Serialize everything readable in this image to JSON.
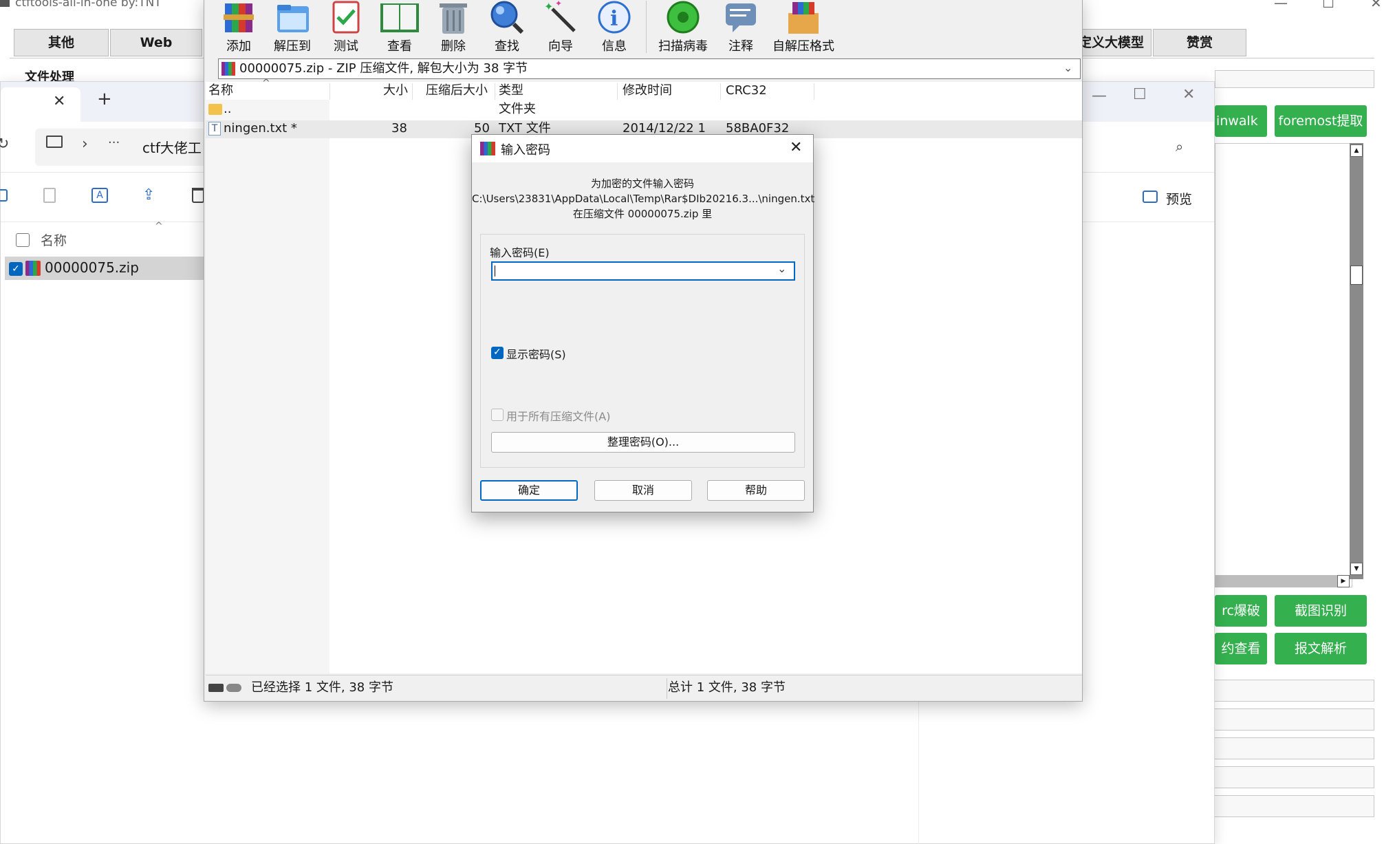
{
  "ctf": {
    "title": "ctftools-all-in-one    by:TNT",
    "tabs": [
      "其他",
      "Web",
      "定义大模型",
      "赞赏"
    ],
    "section": "文件处理",
    "buttons": [
      "inwalk",
      "foremost提取",
      "rc爆破",
      "截图识别",
      "约查看",
      "报文解析"
    ],
    "stray_text": "o。"
  },
  "explorer": {
    "new_tab": "+",
    "breadcrumb_more": "···",
    "breadcrumb_path": "ctf大佬工",
    "preview_label": "预览",
    "col_name": "名称",
    "file_name": "00000075.zip"
  },
  "winrar": {
    "toolbar": [
      "添加",
      "解压到",
      "测试",
      "查看",
      "删除",
      "查找",
      "向导",
      "信息",
      "扫描病毒",
      "注释",
      "自解压格式"
    ],
    "path": "00000075.zip - ZIP 压缩文件, 解包大小为 38 字节",
    "columns": [
      "名称",
      "大小",
      "压缩后大小",
      "类型",
      "修改时间",
      "CRC32"
    ],
    "rows": [
      {
        "name": "..",
        "size": "",
        "packed": "",
        "type": "文件夹",
        "modified": "",
        "crc": ""
      },
      {
        "name": "ningen.txt *",
        "size": "38",
        "packed": "50",
        "type": "TXT 文件",
        "modified": "2014/12/22 1",
        "crc": "58BA0F32"
      }
    ],
    "status_left": "已经选择 1 文件, 38 字节",
    "status_right": "总计 1 文件, 38 字节"
  },
  "dialog": {
    "title": "输入密码",
    "info_line1": "为加密的文件输入密码",
    "info_line2": "C:\\Users\\23831\\AppData\\Local\\Temp\\Rar$DIb20216.3...\\ningen.txt",
    "info_line3": "在压缩文件 00000075.zip 里",
    "input_label": "输入密码(E)",
    "password_value": "",
    "show_password": "显示密码(S)",
    "use_for_all": "用于所有压缩文件(A)",
    "organize": "整理密码(O)...",
    "ok": "确定",
    "cancel": "取消",
    "help": "帮助"
  },
  "colors": {
    "accent": "#0067c0",
    "green": "#34b04f"
  }
}
